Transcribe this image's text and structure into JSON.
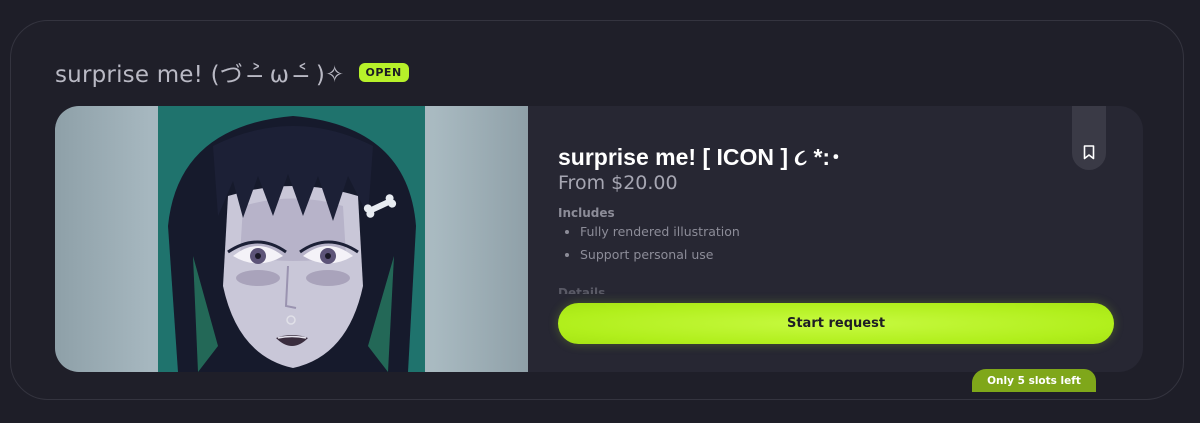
{
  "header": {
    "title": "surprise me! (づ ˃̶ ω ˂̶ )✧",
    "status_badge": "OPEN"
  },
  "listing": {
    "title": "surprise me! [ ICON ] ૮ *:･",
    "price": "From $20.00",
    "includes_heading": "Includes",
    "includes": [
      "Fully rendered illustration",
      "Support personal use"
    ],
    "details_heading": "Details",
    "start_label": "Start request",
    "slots_label": "Only 5 slots left",
    "bookmark_icon": "bookmark-icon"
  },
  "colors": {
    "accent": "#b7f12a",
    "background": "#1e1e28",
    "card": "#272733"
  }
}
